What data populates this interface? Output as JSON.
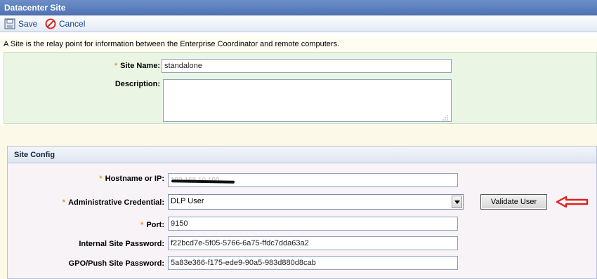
{
  "window": {
    "title": "Datacenter Site"
  },
  "toolbar": {
    "save_label": "Save",
    "cancel_label": "Cancel"
  },
  "info": {
    "text": "A Site is the relay point for information between the Enterprise Coordinator and remote computers."
  },
  "site": {
    "name_label": "Site Name:",
    "name_value": "standalone",
    "description_label": "Description:",
    "description_value": ""
  },
  "config": {
    "title": "Site Config",
    "required_mark": "*",
    "hostname_label": "Hostname or IP:",
    "hostname_value": "192.168.10.100",
    "credential_label": "Administrative Credential:",
    "credential_value": "DLP User",
    "validate_label": "Validate User",
    "port_label": "Port:",
    "port_value": "9150",
    "internal_pw_label": "Internal Site Password:",
    "internal_pw_value": "f22bcd7e-5f05-5766-6a75-ffdc7dda63a2",
    "gpo_pw_label": "GPO/Push Site Password:",
    "gpo_pw_value": "5a83e366-f175-ede9-90a5-983d880d8cab"
  },
  "colors": {
    "titlebar": "#5a7dbd",
    "site_panel": "#eaf5e4",
    "required_mark": "#e39a1a",
    "annotation_arrow": "#e02020"
  }
}
